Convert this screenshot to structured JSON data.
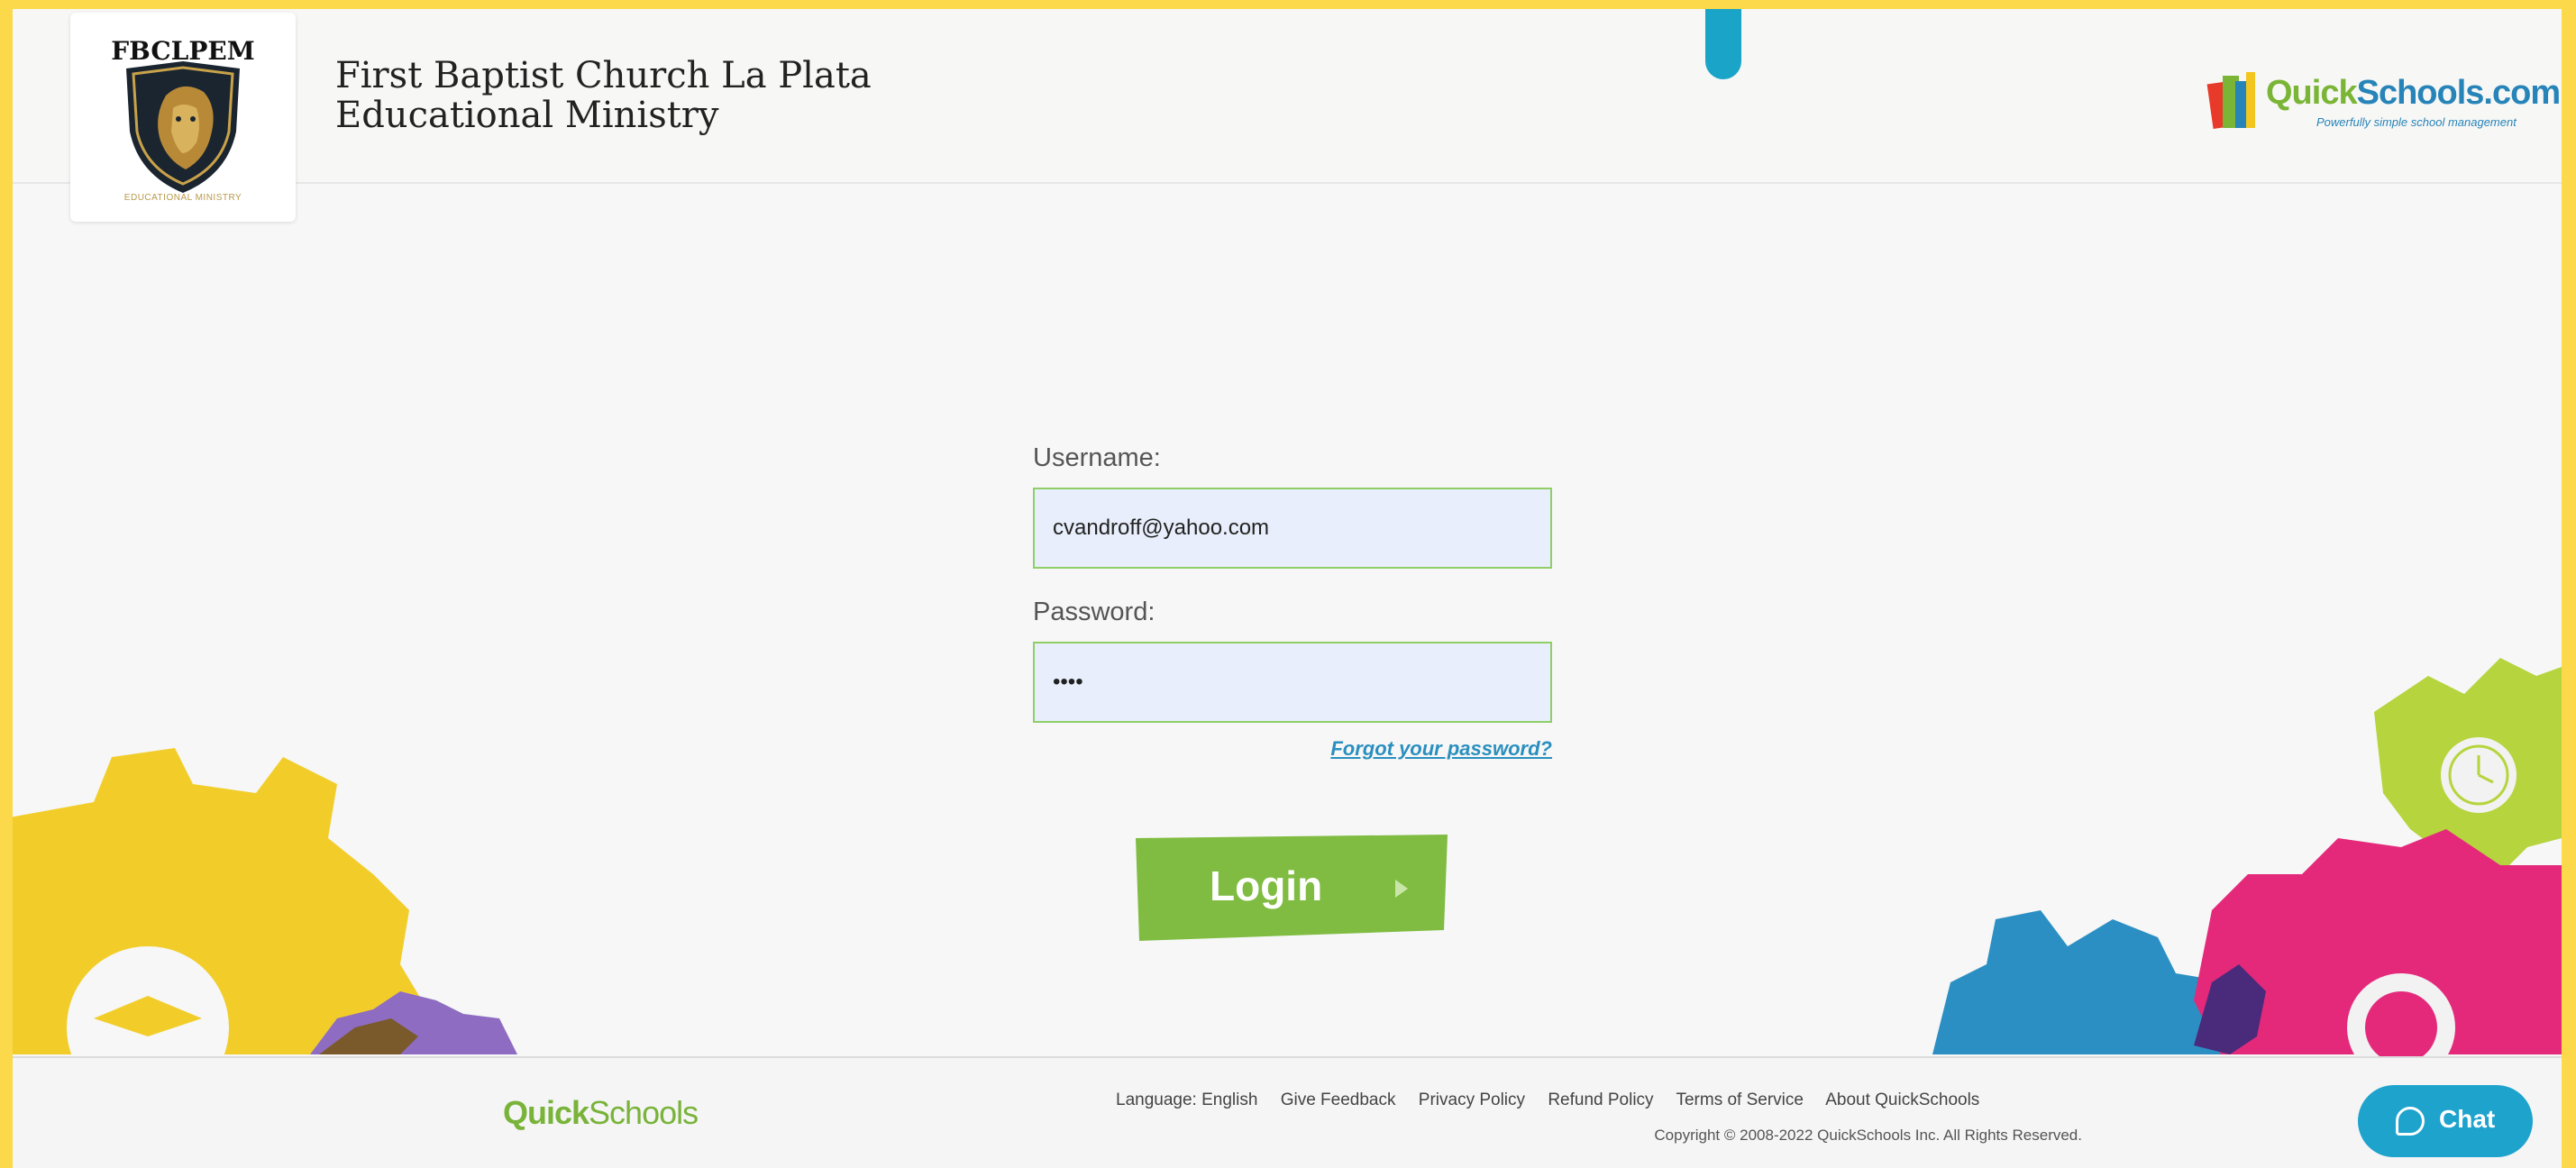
{
  "header": {
    "logo_abbr": "FBCLPEM",
    "logo_sub": "EDUCATIONAL MINISTRY",
    "school_name_line1": "First Baptist Church La Plata",
    "school_name_line2": "Educational Ministry",
    "brand_quick": "Quick",
    "brand_schools": "Schools.com",
    "brand_tagline": "Powerfully simple school management"
  },
  "form": {
    "username_label": "Username:",
    "username_value": "cvandroff@yahoo.com",
    "password_label": "Password:",
    "password_value": "••••",
    "forgot_link": "Forgot your password?",
    "login_label": "Login"
  },
  "footer": {
    "logo_quick": "Quick",
    "logo_schools": "Schools",
    "links": [
      "Language: English",
      "Give Feedback",
      "Privacy Policy",
      "Refund Policy",
      "Terms of Service",
      "About QuickSchools"
    ],
    "copyright": "Copyright © 2008-2022 QuickSchools Inc. All Rights Reserved.",
    "chat_label": "Chat"
  },
  "colors": {
    "accent_green": "#7ab536",
    "accent_blue": "#2784b8",
    "page_border": "#fbd94a",
    "chat_blue": "#1ea3cd"
  },
  "icons": [
    "lion-shield-icon",
    "quickschools-books-icon",
    "gear-icon",
    "clock-icon",
    "graduation-cap-icon",
    "play-arrow-icon",
    "chat-bubble-icon"
  ]
}
